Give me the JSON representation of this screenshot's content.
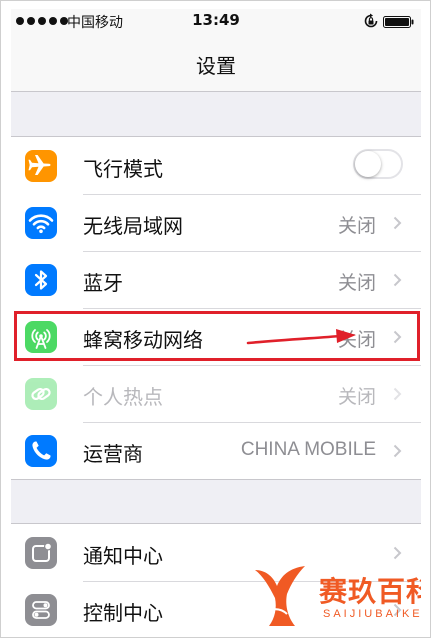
{
  "status_bar": {
    "carrier": "中国移动",
    "time": "13:49",
    "signal_dots": 5
  },
  "nav": {
    "title": "设置"
  },
  "groups": [
    {
      "rows": [
        {
          "label": "飞行模式",
          "icon": "airplane-icon",
          "icon_color": "#ff9500",
          "control": "toggle",
          "toggle_on": false
        },
        {
          "label": "无线局域网",
          "icon": "wifi-icon",
          "icon_color": "#007aff",
          "value": "关闭"
        },
        {
          "label": "蓝牙",
          "icon": "bluetooth-icon",
          "icon_color": "#007aff",
          "value": "关闭"
        },
        {
          "label": "蜂窝移动网络",
          "icon": "cellular-antenna-icon",
          "icon_color": "#4cd964",
          "value": "关闭",
          "highlighted": true
        },
        {
          "label": "个人热点",
          "icon": "hotspot-link-icon",
          "icon_color": "#4cd964",
          "value": "关闭",
          "dimmed": true
        },
        {
          "label": "运营商",
          "icon": "phone-icon",
          "icon_color": "#007aff",
          "value": "CHINA MOBILE"
        }
      ]
    },
    {
      "rows": [
        {
          "label": "通知中心",
          "icon": "notification-center-icon",
          "icon_color": "#8e8e93"
        },
        {
          "label": "控制中心",
          "icon": "control-center-icon",
          "icon_color": "#8e8e93"
        }
      ]
    }
  ],
  "annotation": {
    "highlight_color": "#e0202a",
    "arrow_color": "#e0202a"
  },
  "watermark": {
    "title": "赛玖百科",
    "subtitle": "SAIJIUBAIKE",
    "color": "#f05a24"
  }
}
